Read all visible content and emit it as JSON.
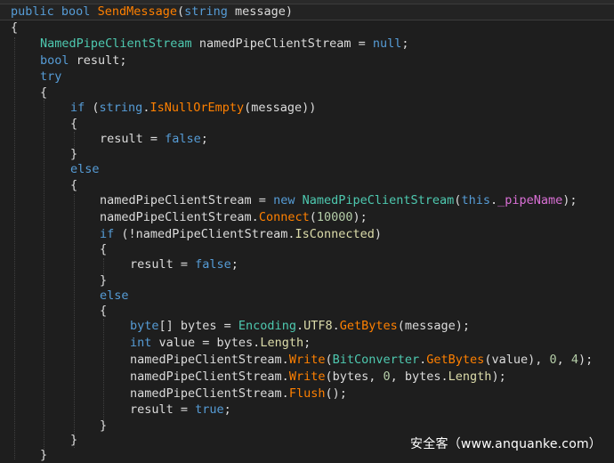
{
  "colors": {
    "background": "#1e1e1e",
    "keyword": "#569cd6",
    "type": "#4ec9b0",
    "method": "#ff8000",
    "property": "#dcdcaa",
    "field": "#da70d6",
    "number": "#b5cea8",
    "text": "#dcdcdc"
  },
  "watermark": "安全客（www.anquanke.com）",
  "code": {
    "l1": {
      "kw1": "public",
      "kw2": "bool",
      "method": "SendMessage",
      "p1": "(",
      "kw3": "string",
      "rest": " message)"
    },
    "l2": {
      "text": "{"
    },
    "l3": {
      "type": "NamedPipeClientStream",
      "mid": " namedPipeClientStream = ",
      "kw": "null",
      "end": ";"
    },
    "l4": {
      "kw": "bool",
      "rest": " result;"
    },
    "l5": {
      "kw": "try"
    },
    "l6": {
      "text": "{"
    },
    "l7": {
      "kw1": "if",
      "p1": " (",
      "kw2": "string",
      "dot": ".",
      "method": "IsNullOrEmpty",
      "rest": "(message))"
    },
    "l8": {
      "text": "{"
    },
    "l9": {
      "pre": "result = ",
      "kw": "false",
      "end": ";"
    },
    "l10": {
      "text": "}"
    },
    "l11": {
      "kw": "else"
    },
    "l12": {
      "text": "{"
    },
    "l13": {
      "pre": "namedPipeClientStream = ",
      "kw": "new",
      "sp": " ",
      "type": "NamedPipeClientStream",
      "p1": "(",
      "kw2": "this",
      "dot": ".",
      "field": "_pipeName",
      "end": ");"
    },
    "l14": {
      "pre": "namedPipeClientStream.",
      "method": "Connect",
      "p1": "(",
      "num": "10000",
      "end": ");"
    },
    "l15": {
      "kw": "if",
      "pre": " (!namedPipeClientStream.",
      "prop": "IsConnected",
      "end": ")"
    },
    "l16": {
      "text": "{"
    },
    "l17": {
      "pre": "result = ",
      "kw": "false",
      "end": ";"
    },
    "l18": {
      "text": "}"
    },
    "l19": {
      "kw": "else"
    },
    "l20": {
      "text": "{"
    },
    "l21": {
      "kw": "byte",
      "pre": "[] bytes = ",
      "type": "Encoding",
      "dot": ".",
      "prop": "UTF8",
      "dot2": ".",
      "method": "GetBytes",
      "end": "(message);"
    },
    "l22": {
      "kw": "int",
      "pre": " value = bytes.",
      "prop": "Length",
      "end": ";"
    },
    "l23": {
      "pre": "namedPipeClientStream.",
      "method": "Write",
      "p1": "(",
      "type": "BitConverter",
      "dot": ".",
      "method2": "GetBytes",
      "mid": "(value), ",
      "num1": "0",
      ", ": ", ",
      "num2": "4",
      "end": ");"
    },
    "l24": {
      "pre": "namedPipeClientStream.",
      "method": "Write",
      "mid": "(bytes, ",
      "num": "0",
      "mid2": ", bytes.",
      "prop": "Length",
      "end": ");"
    },
    "l25": {
      "pre": "namedPipeClientStream.",
      "method": "Flush",
      "end": "();"
    },
    "l26": {
      "pre": "result = ",
      "kw": "true",
      "end": ";"
    },
    "l27": {
      "text": "}"
    },
    "l28": {
      "text": "}"
    },
    "l29": {
      "text": "}"
    }
  }
}
